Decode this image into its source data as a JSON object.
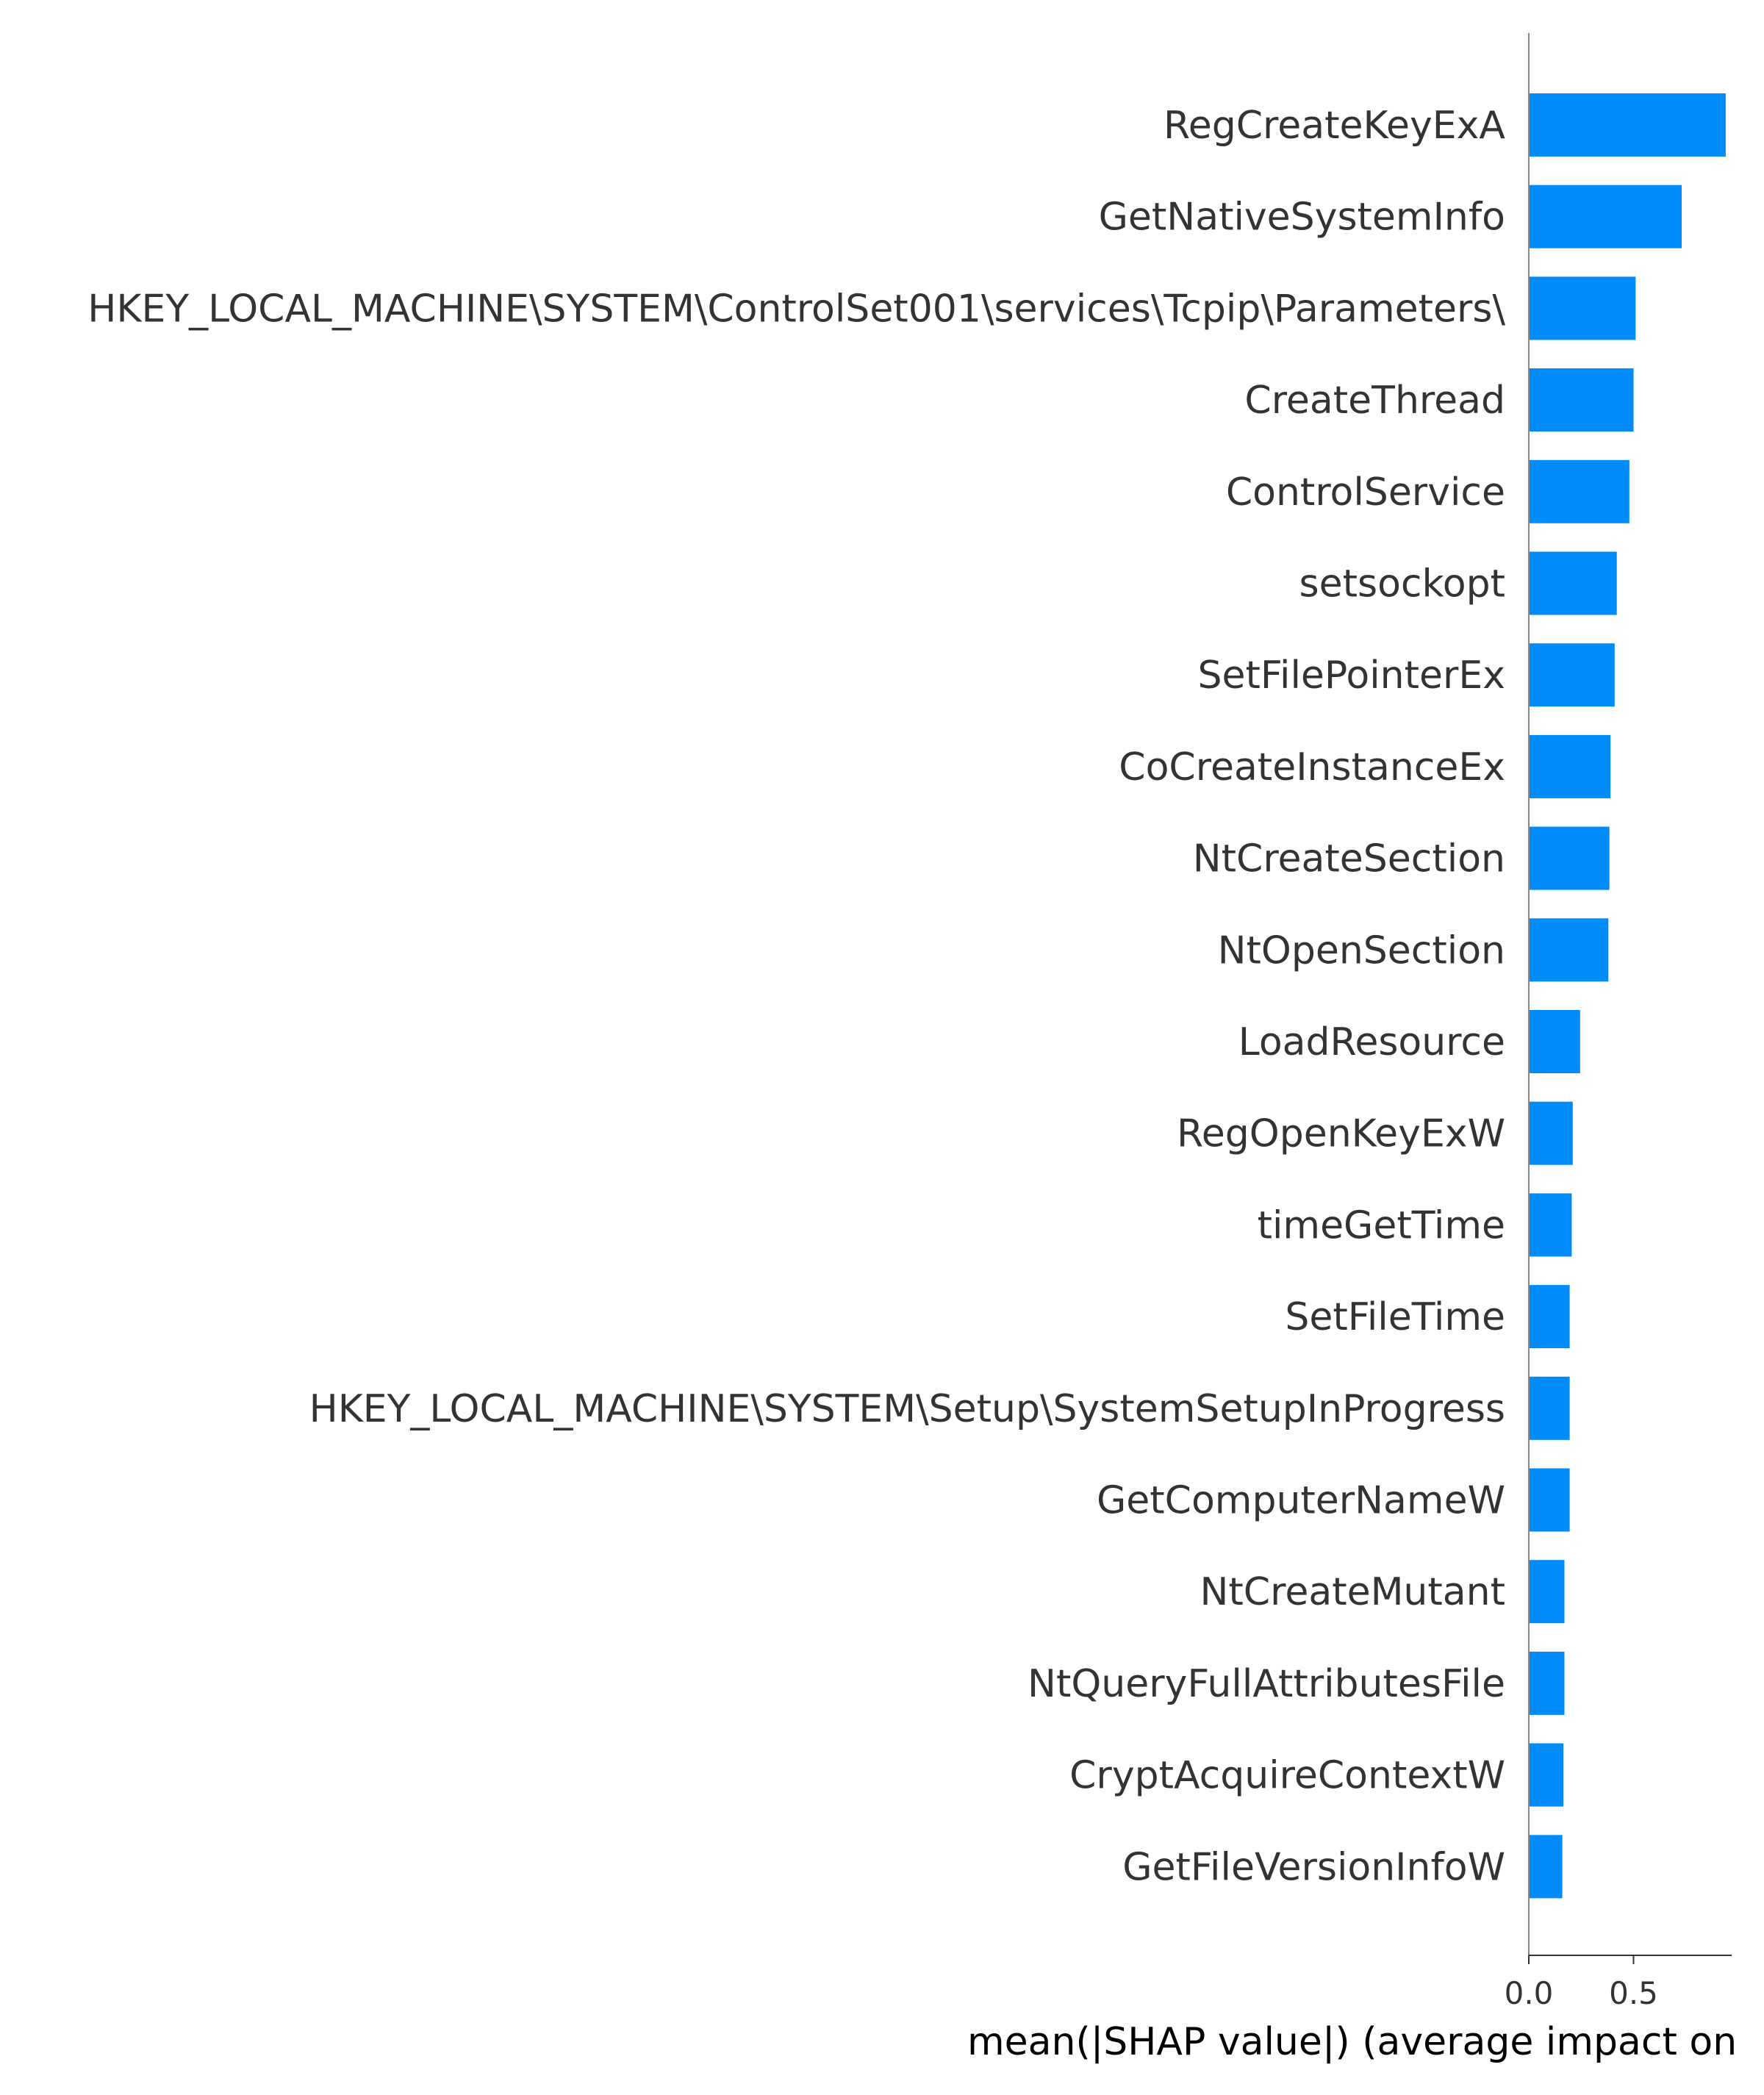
{
  "chart_data": {
    "type": "bar",
    "orientation": "horizontal",
    "categories": [
      "RegCreateKeyExA",
      "GetNativeSystemInfo",
      "HKEY_LOCAL_MACHINE\\SYSTEM\\ControlSet001\\services\\Tcpip\\Parameters\\",
      "CreateThread",
      "ControlService",
      "setsockopt",
      "SetFilePointerEx",
      "CoCreateInstanceEx",
      "NtCreateSection",
      "NtOpenSection",
      "LoadResource",
      "RegOpenKeyExW",
      "timeGetTime",
      "SetFileTime",
      "HKEY_LOCAL_MACHINE\\SYSTEM\\Setup\\SystemSetupInProgress",
      "GetComputerNameW",
      "NtCreateMutant",
      "NtQueryFullAttributesFile",
      "CryptAcquireContextW",
      "GetFileVersionInfoW"
    ],
    "values": [
      0.94,
      0.73,
      0.51,
      0.5,
      0.48,
      0.42,
      0.41,
      0.39,
      0.385,
      0.38,
      0.245,
      0.21,
      0.205,
      0.195,
      0.195,
      0.195,
      0.17,
      0.17,
      0.165,
      0.16
    ],
    "xlabel": "mean(|SHAP value|) (average impact on",
    "ylabel": "",
    "title": "",
    "xticks": [
      "0.0",
      "0.5"
    ],
    "xtick_values": [
      0.0,
      0.5
    ],
    "xlim": [
      0,
      1.0
    ],
    "bar_color": "#008bfb",
    "grid": false,
    "legend": "none"
  }
}
